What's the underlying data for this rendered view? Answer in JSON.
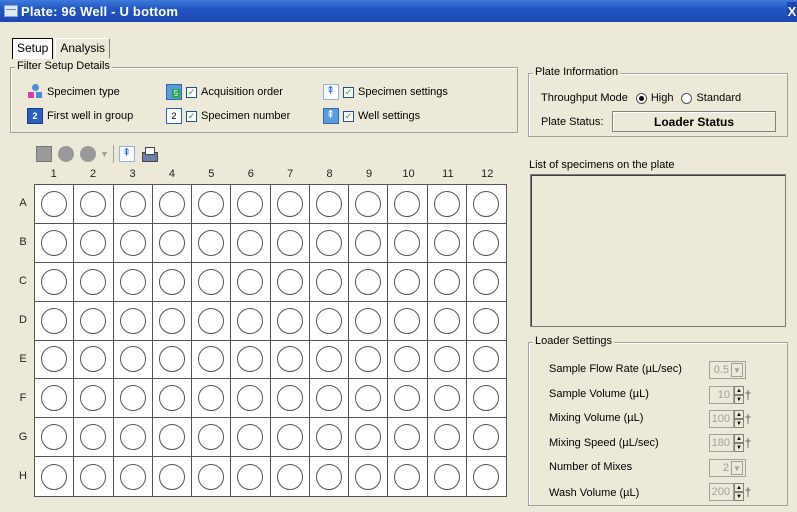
{
  "window": {
    "title": "Plate: 96 Well - U bottom",
    "close": "X"
  },
  "tabs": [
    {
      "label": "Setup"
    },
    {
      "label": "Analysis"
    }
  ],
  "filter_setup": {
    "legend": "Filter Setup Details",
    "items": {
      "specimen_type": {
        "label": "Specimen type"
      },
      "first_well": {
        "label": "First well in group",
        "icon_text": "2"
      },
      "acquisition_order": {
        "label": "Acquisition order",
        "checked": true,
        "icon_text": "5"
      },
      "specimen_number": {
        "label": "Specimen number",
        "checked": true,
        "icon_text": "2"
      },
      "specimen_settings": {
        "label": "Specimen settings",
        "checked": true
      },
      "well_settings": {
        "label": "Well settings",
        "checked": true
      }
    },
    "check_glyph": "✓"
  },
  "toolbar": {
    "dropdown_glyph": "▼"
  },
  "plate": {
    "columns": [
      "1",
      "2",
      "3",
      "4",
      "5",
      "6",
      "7",
      "8",
      "9",
      "10",
      "11",
      "12"
    ],
    "rows": [
      "A",
      "B",
      "C",
      "D",
      "E",
      "F",
      "G",
      "H"
    ]
  },
  "plate_info": {
    "legend": "Plate Information",
    "throughput_label": "Throughput Mode",
    "options": [
      {
        "label": "High",
        "selected": true
      },
      {
        "label": "Standard",
        "selected": false
      }
    ],
    "status_label": "Plate Status:",
    "status_value": "Loader Status"
  },
  "specimens": {
    "label": "List of specimens on the plate",
    "items": []
  },
  "loader_settings": {
    "legend": "Loader Settings",
    "fields": [
      {
        "label": "Sample Flow Rate (µL/sec)",
        "value": "0.5",
        "control": "dropdown"
      },
      {
        "label": "Sample Volume (µL)",
        "value": "10",
        "control": "spinner"
      },
      {
        "label": "Mixing Volume (µL)",
        "value": "100",
        "control": "spinner"
      },
      {
        "label": "Mixing Speed (µL/sec)",
        "value": "180",
        "control": "spinner"
      },
      {
        "label": "Number of Mixes",
        "value": "2",
        "control": "dropdown"
      },
      {
        "label": "Wash Volume (µL)",
        "value": "200",
        "control": "spinner"
      }
    ]
  }
}
